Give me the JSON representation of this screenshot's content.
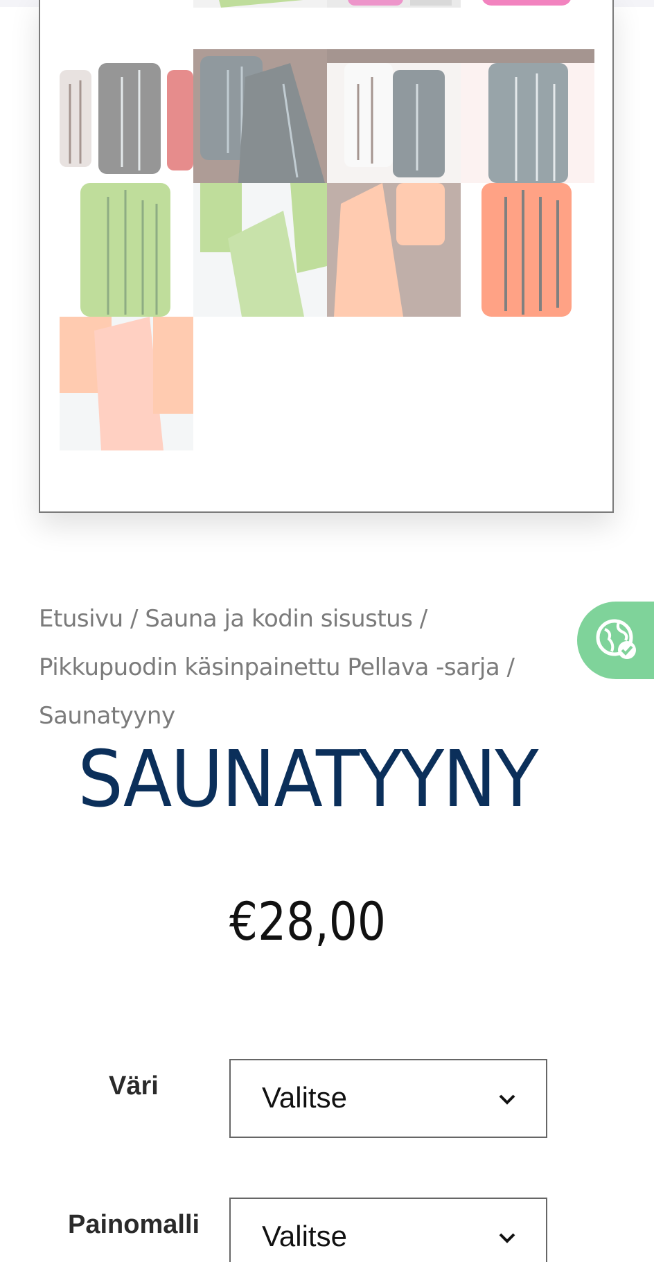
{
  "breadcrumb": {
    "items": [
      "Etusivu",
      "Sauna ja kodin sisustus",
      "Pikkupuodin käsinpainettu Pellava -sarja",
      "Saunatyyny"
    ],
    "separator": "/"
  },
  "product": {
    "title": "SAUNATYYNY",
    "price": "€28,00"
  },
  "options": [
    {
      "label": "Väri",
      "selected": "Valitse"
    },
    {
      "label": "Painomalli",
      "selected": "Valitse"
    }
  ],
  "icons": {
    "globe_button": "globe-check-icon",
    "select_arrow": "chevron-down-icon"
  },
  "colors": {
    "title": "#0b2f5a",
    "breadcrumb": "#7b7b7b",
    "globe_button": "#7fd39a",
    "price": "#111111"
  }
}
